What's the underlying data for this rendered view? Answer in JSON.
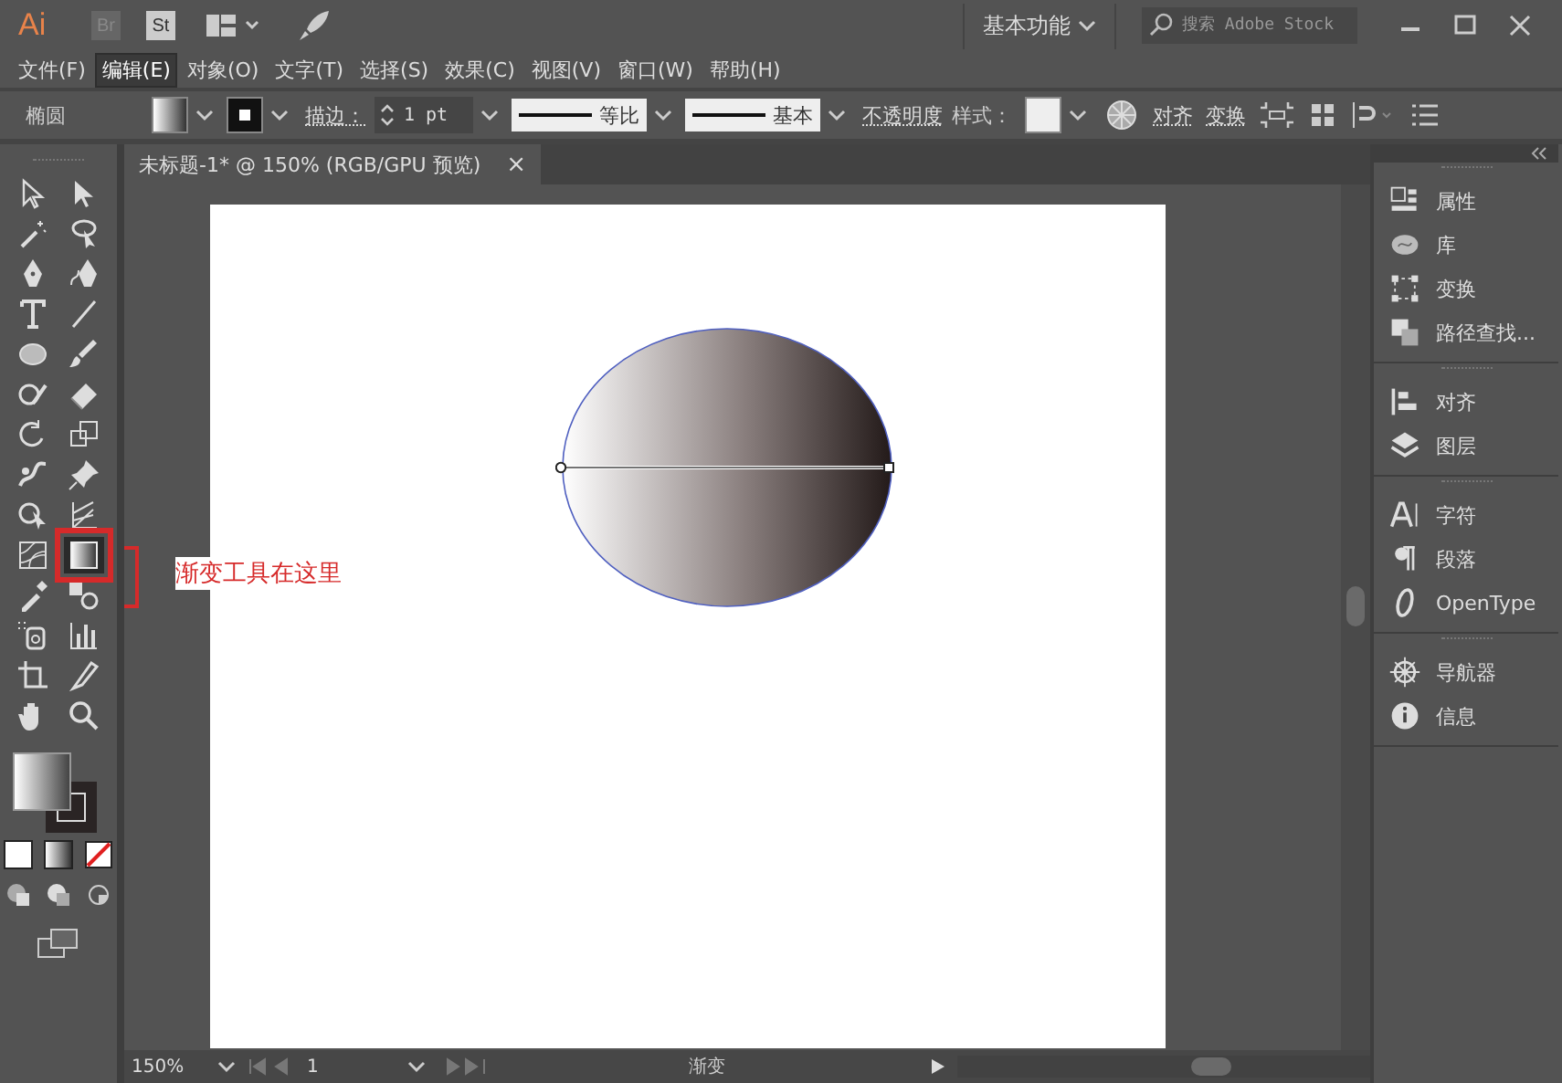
{
  "app_bar": {
    "logo": "Ai",
    "bridge": "Br",
    "stock": "St",
    "workspace": "基本功能",
    "search": {
      "placeholder": "搜索 Adobe Stock"
    }
  },
  "menu": [
    {
      "label": "文件(F)",
      "selected": false
    },
    {
      "label": "编辑(E)",
      "selected": true
    },
    {
      "label": "对象(O)",
      "selected": false
    },
    {
      "label": "文字(T)",
      "selected": false
    },
    {
      "label": "选择(S)",
      "selected": false
    },
    {
      "label": "效果(C)",
      "selected": false
    },
    {
      "label": "视图(V)",
      "selected": false
    },
    {
      "label": "窗口(W)",
      "selected": false
    },
    {
      "label": "帮助(H)",
      "selected": false
    }
  ],
  "control_bar": {
    "object": "椭圆",
    "stroke_label": "描边：",
    "stroke_weight": "1 pt",
    "profile": "等比",
    "brush": "基本",
    "opacity": "不透明度",
    "style_label": "样式：",
    "align": "对齐",
    "transform": "变换"
  },
  "document_tab": {
    "title": "未标题-1* @ 150% (RGB/GPU 预览)",
    "close": "×"
  },
  "tools": [
    {
      "kind": "direct-select",
      "selected": false
    },
    {
      "kind": "select",
      "selected": false
    },
    {
      "kind": "wand",
      "selected": false
    },
    {
      "kind": "lasso",
      "selected": false
    },
    {
      "kind": "pen",
      "selected": false
    },
    {
      "kind": "curvature",
      "selected": false
    },
    {
      "kind": "type",
      "selected": false
    },
    {
      "kind": "line",
      "selected": false
    },
    {
      "kind": "ellipse",
      "selected": false
    },
    {
      "kind": "brush",
      "selected": false
    },
    {
      "kind": "shaper",
      "selected": false
    },
    {
      "kind": "eraser",
      "selected": false
    },
    {
      "kind": "rotate",
      "selected": false
    },
    {
      "kind": "scale",
      "selected": false
    },
    {
      "kind": "warp",
      "selected": false
    },
    {
      "kind": "pin",
      "selected": false
    },
    {
      "kind": "builder",
      "selected": false
    },
    {
      "kind": "perspective",
      "selected": false
    },
    {
      "kind": "mesh",
      "selected": false
    },
    {
      "kind": "gradient",
      "selected": true
    },
    {
      "kind": "eyedropper",
      "selected": false
    },
    {
      "kind": "blend",
      "selected": false
    },
    {
      "kind": "sprayer",
      "selected": false
    },
    {
      "kind": "graph",
      "selected": false
    },
    {
      "kind": "artboard",
      "selected": false
    },
    {
      "kind": "slice",
      "selected": false
    },
    {
      "kind": "hand",
      "selected": false
    },
    {
      "kind": "zoom",
      "selected": false
    }
  ],
  "annotation": "渐变工具在这里",
  "panels": [
    {
      "items": [
        {
          "kind": "properties",
          "label": "属性"
        },
        {
          "kind": "libraries",
          "label": "库"
        },
        {
          "kind": "transform",
          "label": "变换"
        },
        {
          "kind": "pathfinder",
          "label": "路径查找..."
        }
      ]
    },
    {
      "items": [
        {
          "kind": "align",
          "label": "对齐"
        },
        {
          "kind": "layers",
          "label": "图层"
        }
      ]
    },
    {
      "items": [
        {
          "kind": "character",
          "label": "字符"
        },
        {
          "kind": "paragraph",
          "label": "段落"
        },
        {
          "kind": "opentype",
          "label": "OpenType"
        }
      ]
    },
    {
      "items": [
        {
          "kind": "navigator",
          "label": "导航器"
        },
        {
          "kind": "info",
          "label": "信息"
        }
      ]
    }
  ],
  "status_bar": {
    "zoom": "150%",
    "artboard": "1",
    "tool": "渐变"
  }
}
